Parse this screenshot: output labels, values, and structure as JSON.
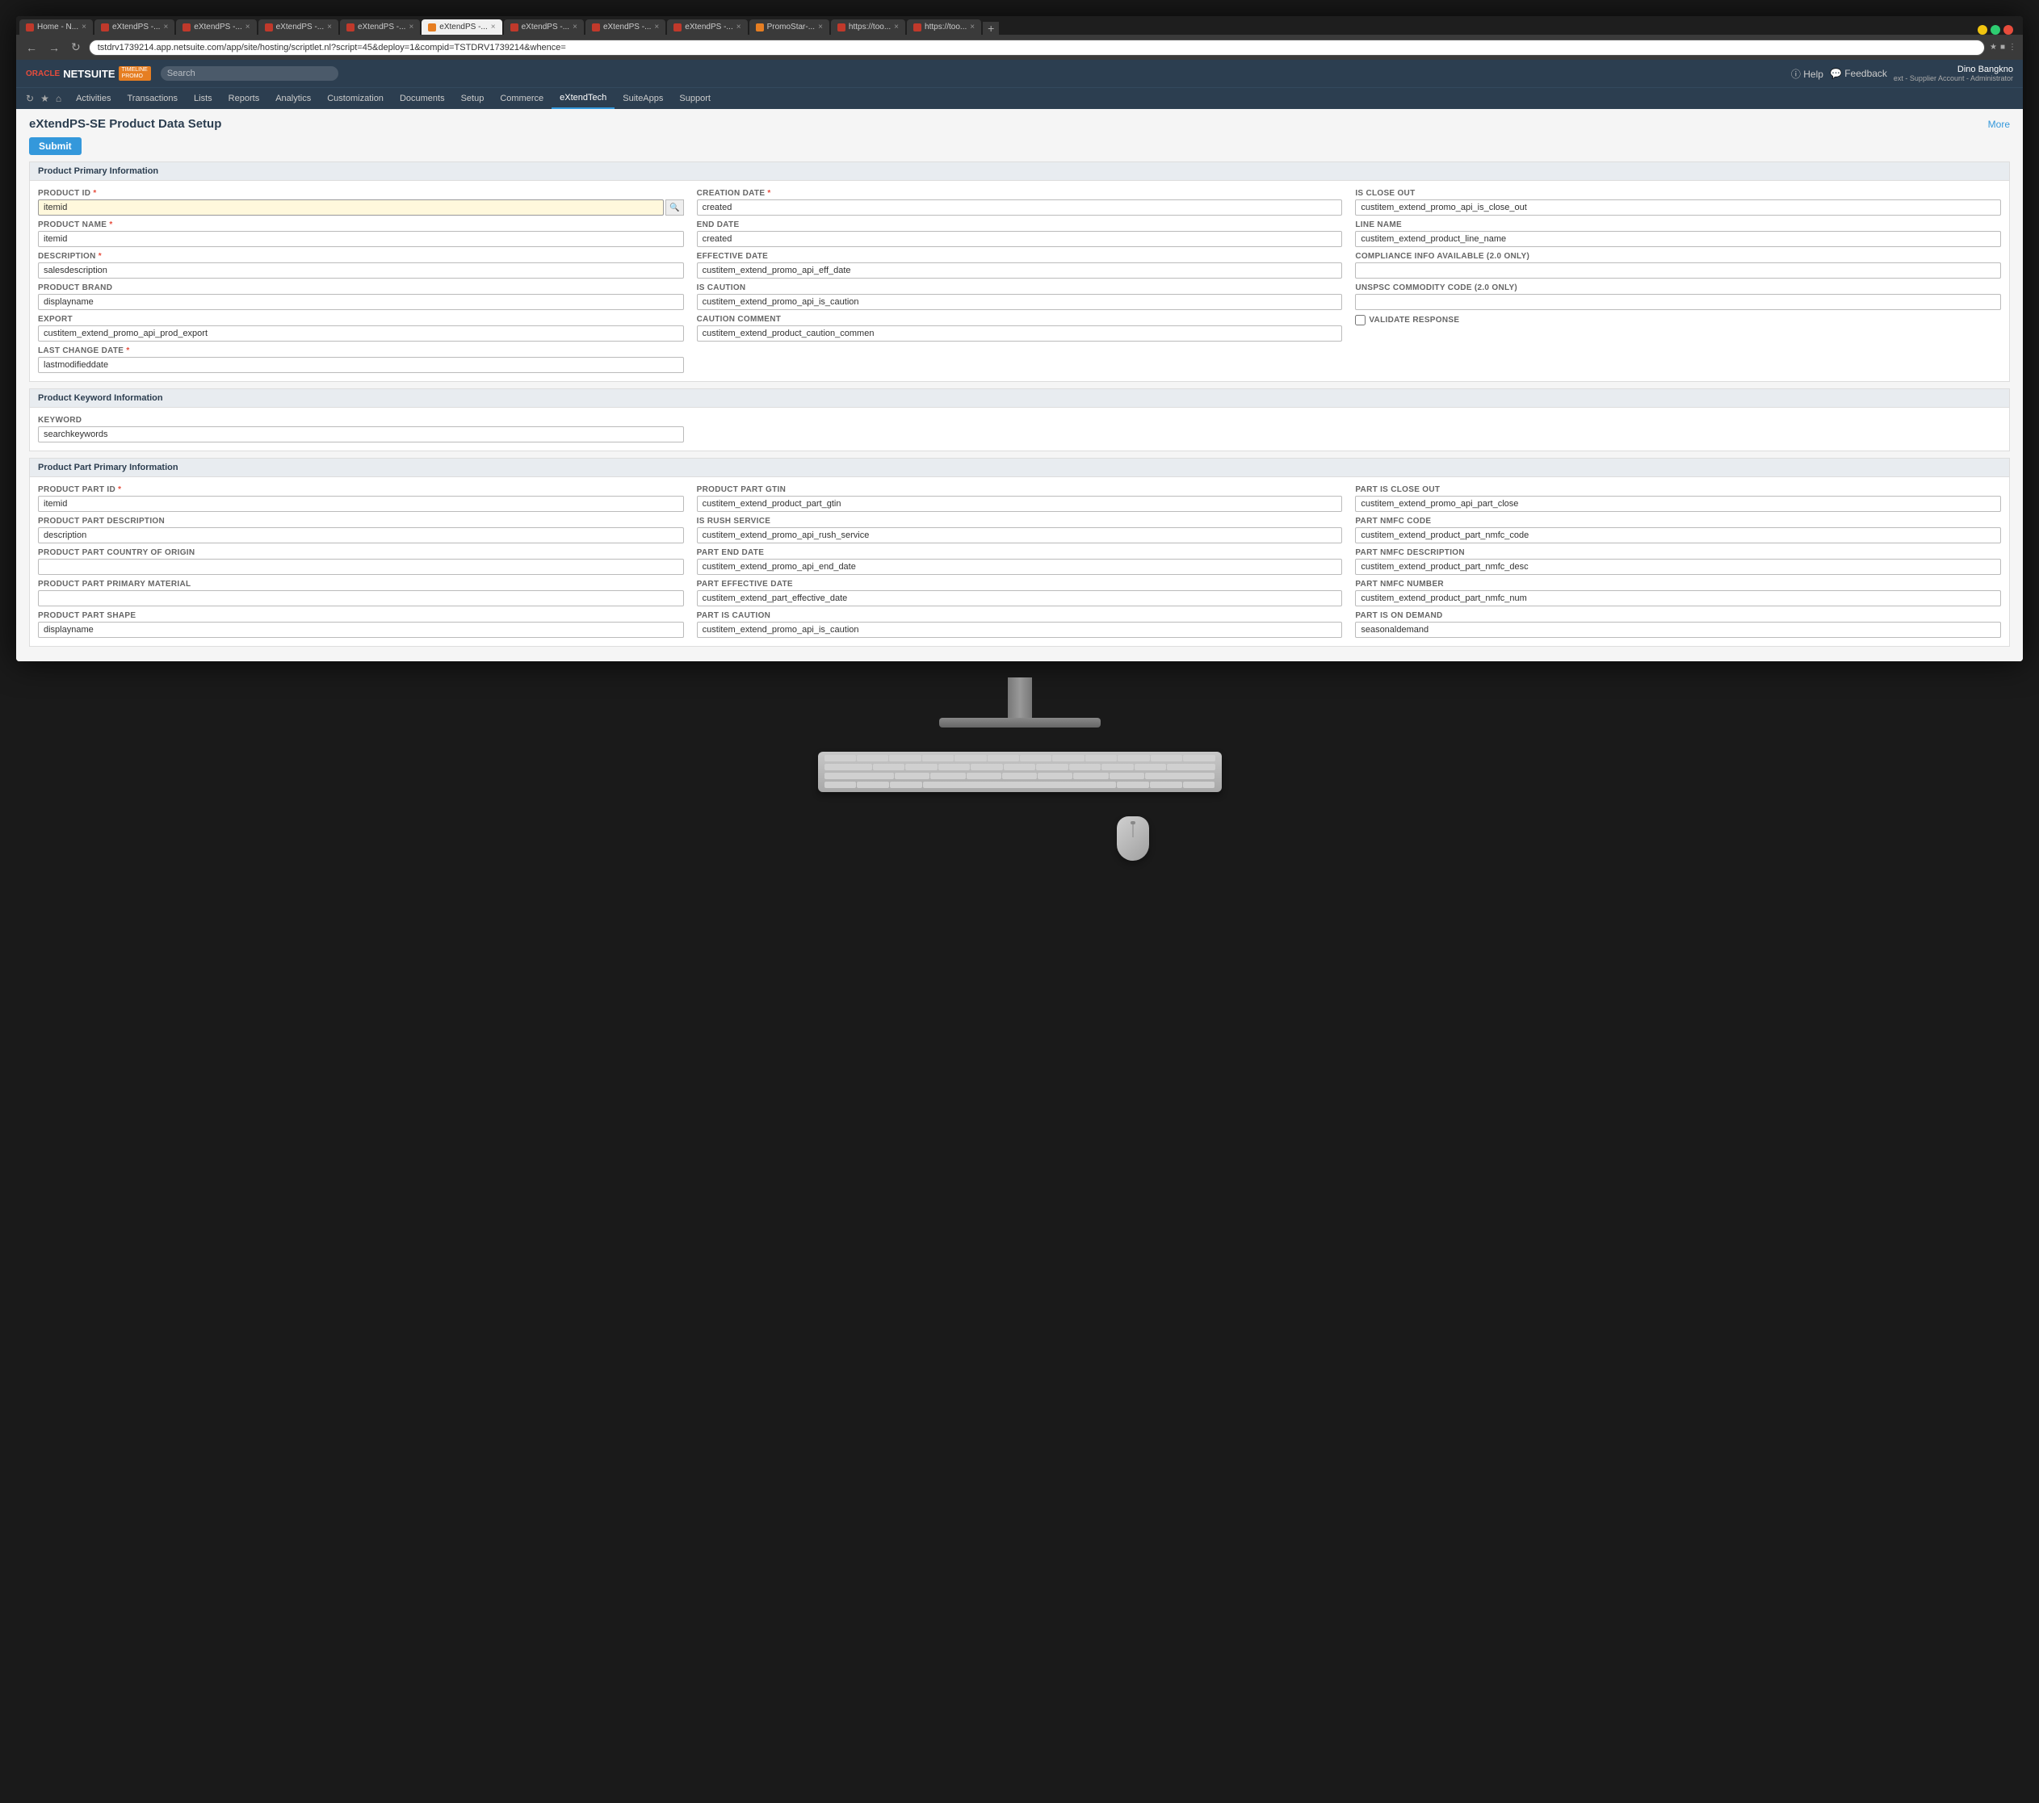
{
  "browser": {
    "address": "tstdrv1739214.app.netsuite.com/app/site/hosting/scriptlet.nl?script=45&deploy=1&compid=TSTDRV1739214&whence=",
    "tabs": [
      {
        "id": "t1",
        "label": "Home - N...",
        "icon": "ns",
        "active": false
      },
      {
        "id": "t2",
        "label": "eXtendPS -...",
        "icon": "ns",
        "active": false
      },
      {
        "id": "t3",
        "label": "eXtendPS -...",
        "icon": "ns",
        "active": false
      },
      {
        "id": "t4",
        "label": "eXtendPS -...",
        "icon": "ns",
        "active": false
      },
      {
        "id": "t5",
        "label": "eXtendPS -...",
        "icon": "ns",
        "active": false
      },
      {
        "id": "t6",
        "label": "eXtendPS -...",
        "icon": "promo",
        "active": true
      },
      {
        "id": "t7",
        "label": "eXtendPS -...",
        "icon": "ns",
        "active": false
      },
      {
        "id": "t8",
        "label": "eXtendPS -...",
        "icon": "ns",
        "active": false
      },
      {
        "id": "t9",
        "label": "eXtendPS -...",
        "icon": "ns",
        "active": false
      },
      {
        "id": "t10",
        "label": "PromoStar-...",
        "icon": "promo",
        "active": false
      },
      {
        "id": "t11",
        "label": "https://too...",
        "icon": "ns",
        "active": false
      },
      {
        "id": "t12",
        "label": "https://too...",
        "icon": "ns",
        "active": false
      }
    ]
  },
  "header": {
    "search_placeholder": "Search",
    "logo_oracle": "ORACLE",
    "logo_netsuite": "NETSUITE",
    "logo_promo": "TIMELINE\nPROMO",
    "user_name": "Dino Bangkno",
    "user_role": "ext - Supplier Account - Administrator",
    "nav_items": [
      {
        "label": "Activities",
        "active": false
      },
      {
        "label": "Transactions",
        "active": false
      },
      {
        "label": "Lists",
        "active": false
      },
      {
        "label": "Reports",
        "active": false
      },
      {
        "label": "Analytics",
        "active": false
      },
      {
        "label": "Customization",
        "active": false
      },
      {
        "label": "Documents",
        "active": false
      },
      {
        "label": "Setup",
        "active": false
      },
      {
        "label": "Commerce",
        "active": false
      },
      {
        "label": "eXtendTech",
        "active": true
      },
      {
        "label": "SuiteApps",
        "active": false
      },
      {
        "label": "Support",
        "active": false
      }
    ]
  },
  "page": {
    "title": "eXtendPS-SE Product Data Setup",
    "more_label": "More",
    "submit_label": "Submit",
    "sections": {
      "primary": {
        "title": "Product Primary Information",
        "fields": {
          "product_id": {
            "label": "PRODUCT ID",
            "required": true,
            "value": "itemid",
            "highlighted": true
          },
          "product_name": {
            "label": "PRODUCT NAME",
            "required": true,
            "value": "itemid"
          },
          "description": {
            "label": "DESCRIPTION",
            "required": true,
            "value": "salesdescription"
          },
          "product_brand": {
            "label": "PRODUCT BRAND",
            "required": false,
            "value": "displayname"
          },
          "export": {
            "label": "EXPORT",
            "required": false,
            "value": "custitem_extend_promo_api_prod_export"
          },
          "last_change_date": {
            "label": "LAST CHANGE DATE",
            "required": true,
            "value": "lastmodifieddate"
          },
          "creation_date": {
            "label": "CREATION DATE",
            "required": true,
            "value": "created"
          },
          "end_date": {
            "label": "END DATE",
            "required": false,
            "value": "created"
          },
          "effective_date": {
            "label": "EFFECTIVE DATE",
            "required": false,
            "value": "custitem_extend_promo_api_eff_date"
          },
          "is_caution": {
            "label": "IS CAUTION",
            "required": false,
            "value": "custitem_extend_promo_api_is_caution"
          },
          "caution_comment": {
            "label": "CAUTION COMMENT",
            "required": false,
            "value": "custitem_extend_product_caution_commen"
          },
          "is_close_out": {
            "label": "IS CLOSE OUT",
            "required": false,
            "value": "custitem_extend_promo_api_is_close_out"
          },
          "line_name": {
            "label": "LINE NAME",
            "required": false,
            "value": "custitem_extend_product_line_name"
          },
          "compliance_info": {
            "label": "COMPLIANCE INFO AVAILABLE (2.0 ONLY)",
            "required": false,
            "value": ""
          },
          "unspsc": {
            "label": "UNSPSC COMMODITY CODE (2.0 ONLY)",
            "required": false,
            "value": ""
          },
          "validate_response": {
            "label": "VALIDATE RESPONSE",
            "required": false,
            "checked": false
          }
        }
      },
      "keyword": {
        "title": "Product Keyword Information",
        "fields": {
          "keyword": {
            "label": "KEYWORD",
            "required": false,
            "value": "searchkeywords"
          }
        }
      },
      "part": {
        "title": "Product Part Primary Information",
        "fields": {
          "product_part_id": {
            "label": "PRODUCT PART ID",
            "required": true,
            "value": "itemid"
          },
          "product_part_description": {
            "label": "PRODUCT PART DESCRIPTION",
            "required": false,
            "value": "description"
          },
          "country_of_origin": {
            "label": "PRODUCT PART COUNTRY OF ORIGIN",
            "required": false,
            "value": ""
          },
          "primary_material": {
            "label": "PRODUCT PART PRIMARY MATERIAL",
            "required": false,
            "value": ""
          },
          "product_part_shape": {
            "label": "PRODUCT PART SHAPE",
            "required": false,
            "value": "displayname"
          },
          "product_part_gtin": {
            "label": "PRODUCT PART GTIN",
            "required": false,
            "value": "custitem_extend_product_part_gtin"
          },
          "is_rush_service": {
            "label": "IS RUSH SERVICE",
            "required": false,
            "value": "custitem_extend_promo_api_rush_service"
          },
          "part_end_date": {
            "label": "PART END DATE",
            "required": false,
            "value": "custitem_extend_promo_api_end_date"
          },
          "part_effective_date": {
            "label": "PART EFFECTIVE DATE",
            "required": false,
            "value": "custitem_extend_part_effective_date"
          },
          "part_is_caution": {
            "label": "PART IS CAUTION",
            "required": false,
            "value": "custitem_extend_promo_api_is_caution"
          },
          "part_is_close_out": {
            "label": "PART IS CLOSE OUT",
            "required": false,
            "value": "custitem_extend_promo_api_part_close"
          },
          "part_nmfc_code": {
            "label": "PART NMFC CODE",
            "required": false,
            "value": "custitem_extend_product_part_nmfc_code"
          },
          "part_nmfc_description": {
            "label": "PART NMFC DESCRIPTION",
            "required": false,
            "value": "custitem_extend_product_part_nmfc_desc"
          },
          "part_nmfc_number": {
            "label": "PART NMFC NUMBER",
            "required": false,
            "value": "custitem_extend_product_part_nmfc_num"
          },
          "part_is_on_demand": {
            "label": "PART IS ON DEMAND",
            "required": false,
            "value": "seasonaldemand"
          }
        }
      }
    }
  }
}
